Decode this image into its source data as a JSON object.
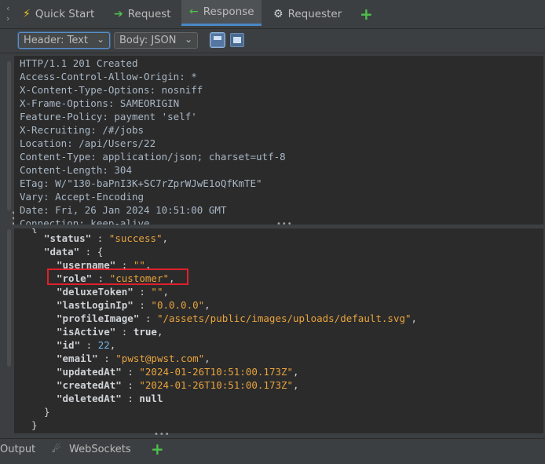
{
  "tabs": {
    "quick_start": "Quick Start",
    "request": "Request",
    "response": "Response",
    "requester": "Requester",
    "add": "+"
  },
  "toolbar": {
    "header_view": "Header: Text",
    "body_view": "Body: JSON"
  },
  "headers": [
    "HTTP/1.1 201 Created",
    "Access-Control-Allow-Origin: *",
    "X-Content-Type-Options: nosniff",
    "X-Frame-Options: SAMEORIGIN",
    "Feature-Policy: payment 'self'",
    "X-Recruiting: /#/jobs",
    "Location: /api/Users/22",
    "Content-Type: application/json; charset=utf-8",
    "Content-Length: 304",
    "ETag: W/\"130-baPnI3K+SC7rZprWJwE1oQfKmTE\"",
    "Vary: Accept-Encoding",
    "Date: Fri, 26 Jan 2024 10:51:00 GMT",
    "Connection: keep-alive"
  ],
  "body": {
    "status_key": "\"status\"",
    "status_val": "\"success\"",
    "data_key": "\"data\"",
    "username_key": "\"username\"",
    "username_val": "\"\"",
    "role_key": "\"role\"",
    "role_val": "\"customer\"",
    "deluxe_key": "\"deluxeToken\"",
    "deluxe_val": "\"\"",
    "lastip_key": "\"lastLoginIp\"",
    "lastip_val": "\"0.0.0.0\"",
    "profile_key": "\"profileImage\"",
    "profile_val": "\"/assets/public/images/uploads/default.svg\"",
    "active_key": "\"isActive\"",
    "active_val": "true",
    "id_key": "\"id\"",
    "id_val": "22",
    "email_key": "\"email\"",
    "email_val": "\"pwst@pwst.com\"",
    "updated_key": "\"updatedAt\"",
    "updated_val": "\"2024-01-26T10:51:00.173Z\"",
    "created_key": "\"createdAt\"",
    "created_val": "\"2024-01-26T10:51:00.173Z\"",
    "deleted_key": "\"deletedAt\"",
    "deleted_val": "null"
  },
  "bottom": {
    "output": "Output",
    "websockets": "WebSockets",
    "add": "+"
  },
  "colors": {
    "accent": "#4a88c7",
    "highlight": "#e0202a",
    "string": "#e8a33d",
    "number": "#6fb6e8"
  },
  "icons": [
    "chevron-up-icon",
    "chevron-down-icon",
    "lightning-icon",
    "arrow-right-icon",
    "arrow-left-icon",
    "requester-icon",
    "plus-icon",
    "layout-split-icon",
    "layout-tabs-icon",
    "websocket-icon"
  ]
}
